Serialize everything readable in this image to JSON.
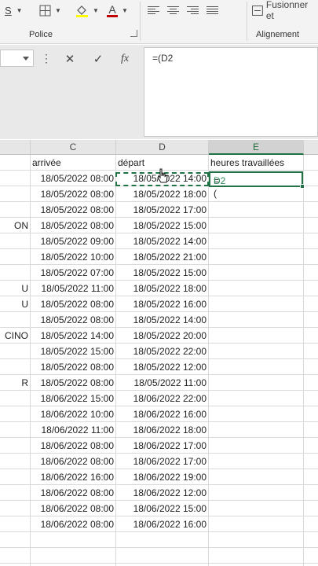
{
  "ribbon": {
    "group_font_label": "Police",
    "group_alignment_label": "Alignement",
    "merge_label": "Fusionner et",
    "strike_glyph": "S",
    "font_color_glyph": "A"
  },
  "formula_bar": {
    "namebox_value": "",
    "cancel_glyph": "✕",
    "enter_glyph": "✓",
    "fx_glyph": "fx",
    "formula": "=(D2"
  },
  "columns": [
    {
      "letter": "C",
      "active": false
    },
    {
      "letter": "D",
      "active": false
    },
    {
      "letter": "E",
      "active": true
    }
  ],
  "sheet": {
    "headers": {
      "c": "arrivée",
      "d": "départ",
      "e": "heures travaillées"
    },
    "active_cell_text": "=(",
    "active_cell_ref": "D2",
    "rows": [
      {
        "a": "",
        "c": "18/05/2022 08:00",
        "d": "18/05/2022 14:00"
      },
      {
        "a": "",
        "c": "18/05/2022 08:00",
        "d": "18/05/2022 18:00"
      },
      {
        "a": "",
        "c": "18/05/2022 08:00",
        "d": "18/05/2022 17:00"
      },
      {
        "a": "ON",
        "c": "18/05/2022 08:00",
        "d": "18/05/2022 15:00"
      },
      {
        "a": "",
        "c": "18/05/2022 09:00",
        "d": "18/05/2022 14:00"
      },
      {
        "a": "",
        "c": "18/05/2022 10:00",
        "d": "18/05/2022 21:00"
      },
      {
        "a": "",
        "c": "18/05/2022 07:00",
        "d": "18/05/2022 15:00"
      },
      {
        "a": "U",
        "c": "18/05/2022 11:00",
        "d": "18/05/2022 18:00"
      },
      {
        "a": "U",
        "c": "18/05/2022 08:00",
        "d": "18/05/2022 16:00"
      },
      {
        "a": "",
        "c": "18/05/2022 08:00",
        "d": "18/05/2022 14:00"
      },
      {
        "a": "CINO",
        "c": "18/05/2022 14:00",
        "d": "18/05/2022 20:00"
      },
      {
        "a": "",
        "c": "18/05/2022 15:00",
        "d": "18/05/2022 22:00"
      },
      {
        "a": "",
        "c": "18/05/2022 08:00",
        "d": "18/05/2022 12:00"
      },
      {
        "a": "R",
        "c": "18/05/2022 08:00",
        "d": "18/05/2022 11:00"
      },
      {
        "a": "",
        "c": "18/06/2022 15:00",
        "d": "18/06/2022 22:00"
      },
      {
        "a": "",
        "c": "18/06/2022 10:00",
        "d": "18/06/2022 16:00"
      },
      {
        "a": "",
        "c": "18/06/2022 11:00",
        "d": "18/06/2022 18:00"
      },
      {
        "a": "",
        "c": "18/06/2022 08:00",
        "d": "18/06/2022 17:00"
      },
      {
        "a": "",
        "c": "18/06/2022 08:00",
        "d": "18/06/2022 17:00"
      },
      {
        "a": "",
        "c": "18/06/2022 16:00",
        "d": "18/06/2022 19:00"
      },
      {
        "a": "",
        "c": "18/06/2022 08:00",
        "d": "18/06/2022 12:00"
      },
      {
        "a": "",
        "c": "18/06/2022 08:00",
        "d": "18/06/2022 15:00"
      },
      {
        "a": "",
        "c": "18/06/2022 08:00",
        "d": "18/06/2022 16:00"
      }
    ]
  },
  "colors": {
    "accent": "#217346",
    "ref_text": "#2e8b57",
    "font_color_bar": "#c00000",
    "highlight_bar": "#ffff00"
  }
}
